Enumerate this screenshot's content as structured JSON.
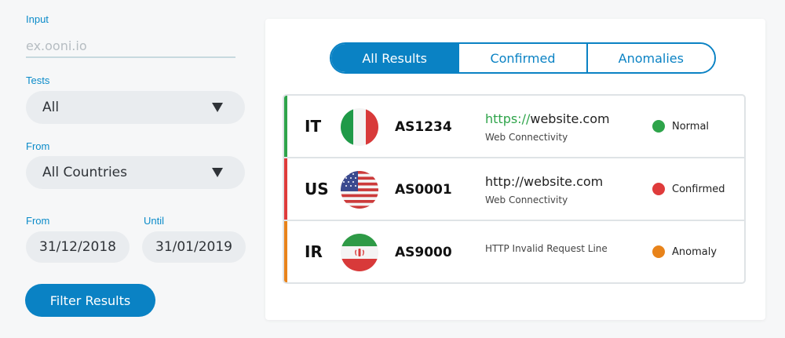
{
  "filters": {
    "input_label": "Input",
    "input_placeholder": "ex.ooni.io",
    "input_value": "",
    "tests_label": "Tests",
    "tests_value": "All",
    "from_country_label": "From",
    "country_value": "All Countries",
    "date_from_label": "From",
    "date_until_label": "Until",
    "date_from": "31/12/2018",
    "date_until": "31/01/2019",
    "filter_button": "Filter Results"
  },
  "tabs": [
    {
      "label": "All Results",
      "active": true
    },
    {
      "label": "Confirmed",
      "active": false
    },
    {
      "label": "Anomalies",
      "active": false
    }
  ],
  "results": [
    {
      "country": "IT",
      "flag": "italy-flag",
      "asn": "AS1234",
      "url_protocol": "https://",
      "url_host": "website.com",
      "test": "Web Connectivity",
      "status": "Normal",
      "color": "#2ea44a"
    },
    {
      "country": "US",
      "flag": "usa-flag",
      "asn": "AS0001",
      "url_protocol": "http://",
      "url_host": "website.com",
      "test": "Web Connectivity",
      "status": "Confirmed",
      "color": "#df3b3b"
    },
    {
      "country": "IR",
      "flag": "iran-flag",
      "asn": "AS9000",
      "url_protocol": "",
      "url_host": "",
      "test": "HTTP Invalid Request Line",
      "status": "Anomaly",
      "color": "#e8831a"
    }
  ],
  "colors": {
    "accent": "#0a82c4",
    "normal": "#2ea44a",
    "confirmed": "#df3b3b",
    "anomaly": "#e8831a"
  }
}
